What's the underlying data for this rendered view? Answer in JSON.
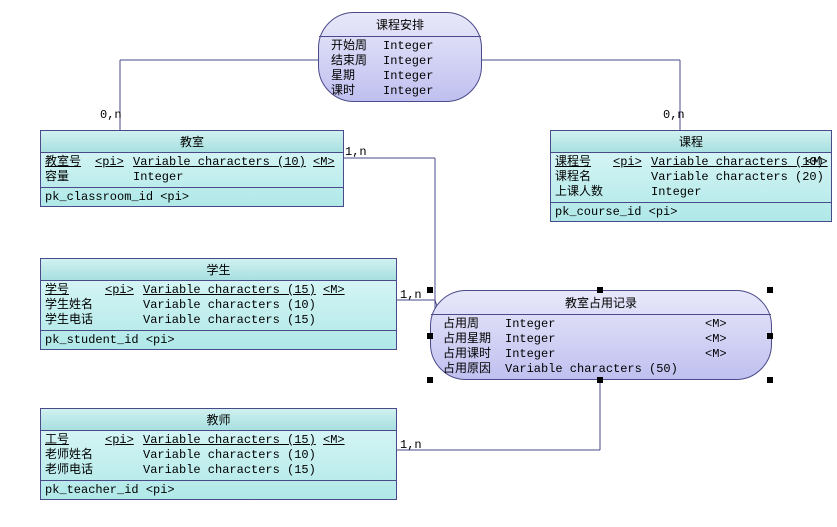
{
  "relationship1": {
    "title": "课程安排",
    "rows": [
      {
        "name": "开始周",
        "type": "Integer"
      },
      {
        "name": "结束周",
        "type": "Integer"
      },
      {
        "name": "星期",
        "type": "Integer"
      },
      {
        "name": "课时",
        "type": "Integer"
      }
    ]
  },
  "relationship2": {
    "title": "教室占用记录",
    "rows": [
      {
        "name": "占用周",
        "type": "Integer",
        "m": "<M>"
      },
      {
        "name": "占用星期",
        "type": "Integer",
        "m": "<M>"
      },
      {
        "name": "占用课时",
        "type": "Integer",
        "m": "<M>"
      },
      {
        "name": "占用原因",
        "type": "Variable characters (50)",
        "m": ""
      }
    ]
  },
  "classroom": {
    "title": "教室",
    "rows": [
      {
        "name": "教室号",
        "pi": "<pi>",
        "type": "Variable characters (10)",
        "m": "<M>",
        "u": true
      },
      {
        "name": "容量",
        "pi": "",
        "type": "Integer",
        "m": "",
        "u": false
      }
    ],
    "pk": "pk_classroom_id <pi>"
  },
  "course": {
    "title": "课程",
    "rows": [
      {
        "name": "课程号",
        "pi": "<pi>",
        "type": "Variable characters (10)",
        "m": "<M>",
        "u": true
      },
      {
        "name": "课程名",
        "pi": "",
        "type": "Variable characters (20)",
        "m": "",
        "u": false
      },
      {
        "name": "上课人数",
        "pi": "",
        "type": "Integer",
        "m": "",
        "u": false
      }
    ],
    "pk": "pk_course_id <pi>"
  },
  "student": {
    "title": "学生",
    "rows": [
      {
        "name": "学号",
        "pi": "<pi>",
        "type": "Variable characters (15)",
        "m": "<M>",
        "u": true
      },
      {
        "name": "学生姓名",
        "pi": "",
        "type": "Variable characters (10)",
        "m": "",
        "u": false
      },
      {
        "name": "学生电话",
        "pi": "",
        "type": "Variable characters (15)",
        "m": "",
        "u": false
      }
    ],
    "pk": "pk_student_id <pi>"
  },
  "teacher": {
    "title": "教师",
    "rows": [
      {
        "name": "工号",
        "pi": "<pi>",
        "type": "Variable characters (15)",
        "m": "<M>",
        "u": true
      },
      {
        "name": "老师姓名",
        "pi": "",
        "type": "Variable characters (10)",
        "m": "",
        "u": false
      },
      {
        "name": "老师电话",
        "pi": "",
        "type": "Variable characters (15)",
        "m": "",
        "u": false
      }
    ],
    "pk": "pk_teacher_id <pi>"
  },
  "labels": {
    "c1": "0,n",
    "c2": "0,n",
    "c3": "1,n",
    "c4": "1,n",
    "c5": "1,n"
  }
}
